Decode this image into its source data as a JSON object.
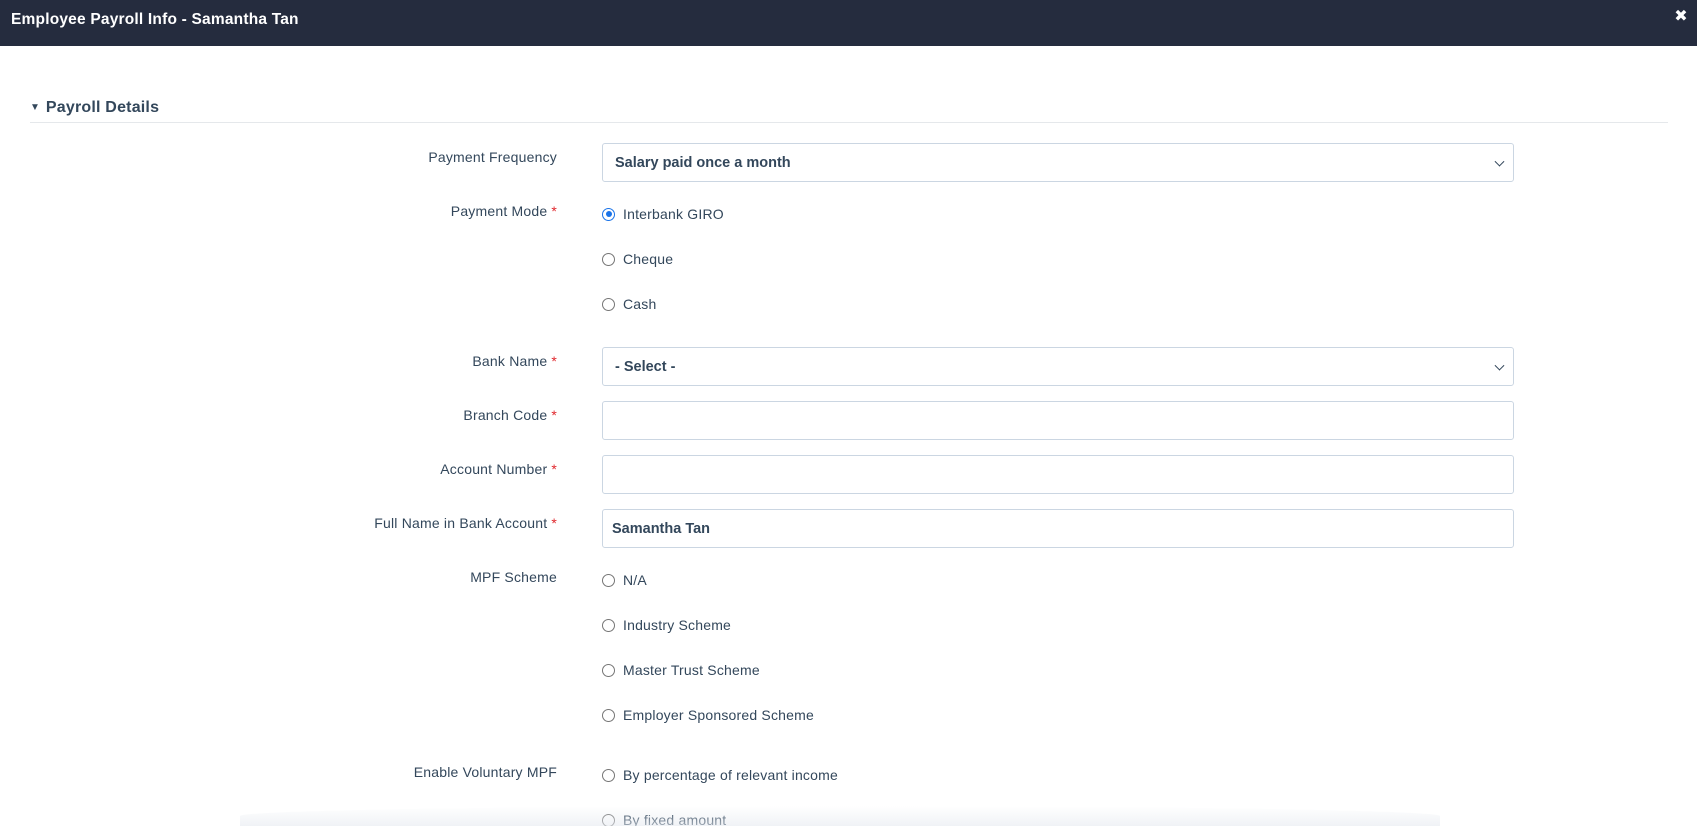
{
  "window": {
    "title": "Employee Payroll Info - Samantha Tan",
    "close_icon": "close-icon"
  },
  "section": {
    "title": "Payroll Details",
    "caret_icon": "caret-down-icon"
  },
  "required_marker": "*",
  "fields": {
    "payment_frequency": {
      "label": "Payment Frequency",
      "value": "Salary paid once a month"
    },
    "payment_mode": {
      "label": "Payment Mode",
      "options": [
        "Interbank GIRO",
        "Cheque",
        "Cash"
      ],
      "selected": "Interbank GIRO"
    },
    "bank_name": {
      "label": "Bank Name",
      "value": "- Select -"
    },
    "branch_code": {
      "label": "Branch Code",
      "value": ""
    },
    "account_number": {
      "label": "Account Number",
      "value": ""
    },
    "full_name": {
      "label": "Full Name in Bank Account",
      "value": "Samantha Tan"
    },
    "mpf_scheme": {
      "label": "MPF Scheme",
      "options": [
        "N/A",
        "Industry Scheme",
        "Master Trust Scheme",
        "Employer Sponsored Scheme"
      ],
      "selected": null
    },
    "voluntary_mpf": {
      "label": "Enable Voluntary MPF",
      "options": [
        "By percentage of relevant income",
        "By fixed amount"
      ],
      "selected": null
    }
  },
  "colors": {
    "titlebar_bg": "#252c3e",
    "text": "#33475b",
    "required": "#e0262c",
    "radio_checked": "#1a73e8",
    "input_border": "#cbd6e2"
  }
}
